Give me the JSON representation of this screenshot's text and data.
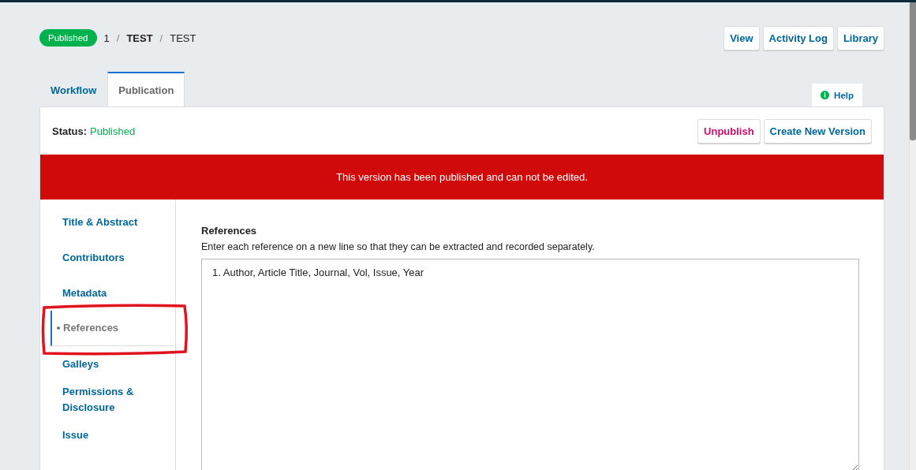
{
  "header": {
    "status_badge": "Published",
    "separator": "/",
    "breadcrumb": [
      {
        "text": "1",
        "bold": false
      },
      {
        "text": "TEST",
        "bold": true
      },
      {
        "text": "TEST",
        "bold": false
      }
    ],
    "buttons": [
      "View",
      "Activity Log",
      "Library"
    ]
  },
  "tabs": [
    {
      "label": "Workflow",
      "selected": false
    },
    {
      "label": "Publication",
      "selected": true
    }
  ],
  "help": {
    "label": "Help"
  },
  "status": {
    "label": "Status:",
    "value": "Published"
  },
  "actions": [
    {
      "label": "Unpublish",
      "kind": "danger"
    },
    {
      "label": "Create New Version",
      "kind": "normal"
    }
  ],
  "notice": "This version has been published and can not be edited.",
  "sidebar": {
    "items": [
      {
        "label": "Title & Abstract",
        "selected": false
      },
      {
        "label": "Contributors",
        "selected": false
      },
      {
        "label": "Metadata",
        "selected": false
      },
      {
        "label": "References",
        "selected": true,
        "annotated": true
      },
      {
        "label": "Galleys",
        "selected": false
      },
      {
        "label": "Permissions & Disclosure",
        "selected": false
      },
      {
        "label": "Issue",
        "selected": false
      }
    ]
  },
  "form": {
    "label": "References",
    "description": "Enter each reference on a new line so that they can be extracted and recorded separately.",
    "value": "1. Author, Article Title, Journal, Vol, Issue, Year"
  }
}
